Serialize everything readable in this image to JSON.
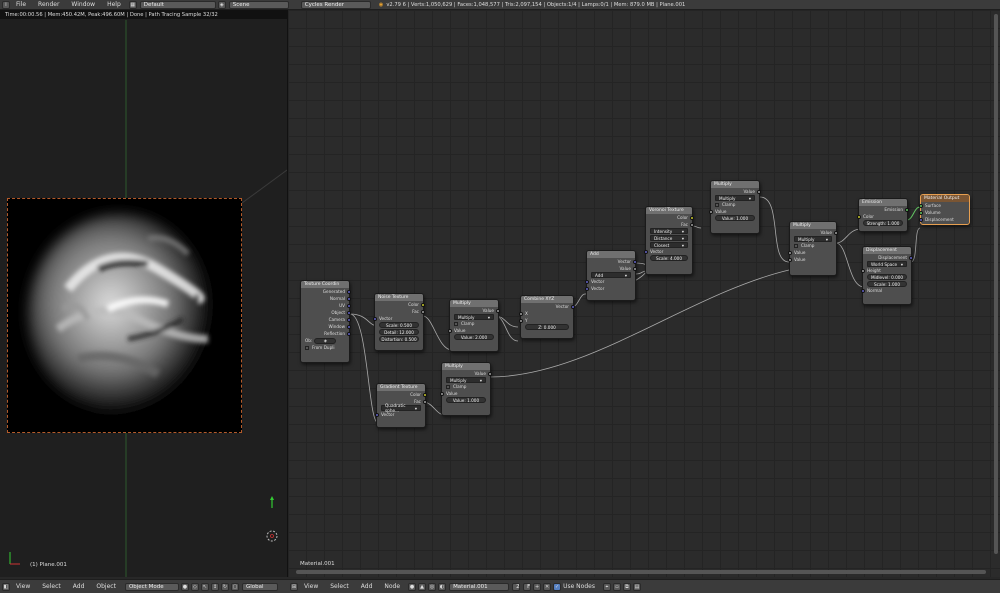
{
  "topbar": {
    "menu": [
      "File",
      "Render",
      "Window",
      "Help"
    ],
    "screen_layout": "Default",
    "scene": "Scene",
    "engine": "Cycles Render",
    "stats": "v2.79 6 | Verts:1,050,629 | Faces:1,048,577 | Tris:2,097,154 | Objects:1/4 | Lamps:0/1 | Mem: 879.0 MB | Plane.001"
  },
  "viewport": {
    "render_status": "Time:00:00.56 | Mem:450.42M, Peak:496.60M | Done | Path Tracing Sample 32/32",
    "object_label": "(1) Plane.001"
  },
  "nodeeditor": {
    "material_label": "Material.001",
    "nodes": {
      "texcoord": {
        "title": "Texture Coordin",
        "outputs": [
          "Generated",
          "Normal",
          "UV",
          "Object",
          "Camera",
          "Window",
          "Reflection"
        ],
        "ob_label": "Ob:",
        "from_dupli": "From Dupli"
      },
      "noise": {
        "title": "Noise Texture",
        "out_color": "Color",
        "out_fac": "Fac",
        "in_vector": "Vector",
        "scale": "Scale: 0.500",
        "detail": "Detail: 12.000",
        "distortion": "Distortion: 0.500"
      },
      "multiply1": {
        "title": "Multiply",
        "out": "Value",
        "op": "Multiply",
        "clamp": "Clamp",
        "in_value": "Value",
        "value2": "Value: 2.000"
      },
      "combine": {
        "title": "Combine XYZ",
        "out": "Vector",
        "x": "X",
        "y": "Y",
        "z": "Z: 0.000"
      },
      "add": {
        "title": "Add",
        "out_vector": "Vector",
        "out_value": "Value",
        "op": "Add",
        "in1": "Vector",
        "in2": "Vector"
      },
      "voronoi": {
        "title": "Voronoi Texture",
        "out_color": "Color",
        "out_fac": "Fac",
        "coloring": "Intensity",
        "metric": "Distance",
        "feature": "Closest",
        "in_vector": "Vector",
        "scale": "Scale: 4.000"
      },
      "multiply2": {
        "title": "Multiply",
        "out": "Value",
        "op": "Multiply",
        "clamp": "Clamp",
        "in_value": "Value",
        "value2": "Value: 1.000"
      },
      "multiply3": {
        "title": "Multiply",
        "out": "Value",
        "op": "Multiply",
        "clamp": "Clamp",
        "in_value": "Value",
        "in_value2": "Value"
      },
      "emission": {
        "title": "Emission",
        "out": "Emission",
        "in_color": "Color",
        "strength": "Strength: 1.000"
      },
      "displacement": {
        "title": "Displacement",
        "out": "Displacement",
        "space": "World Space",
        "height": "Height",
        "midlevel": "Midlevel: 0.000",
        "scale": "Scale: 1.000",
        "normal": "Normal"
      },
      "output": {
        "title": "Material Output",
        "surface": "Surface",
        "volume": "Volume",
        "displacement": "Displacement"
      },
      "gradient": {
        "title": "Gradient Texture",
        "out_color": "Color",
        "out_fac": "Fac",
        "type": "Quadratic sphe...",
        "in_vector": "Vector"
      },
      "multiply4": {
        "title": "Multiply",
        "out": "Value",
        "op": "Multiply",
        "clamp": "Clamp",
        "in_value": "Value",
        "value2": "Value: 1.000"
      }
    }
  },
  "bottombar": {
    "left_menu": [
      "View",
      "Select",
      "Add",
      "Object"
    ],
    "mode": "Object Mode",
    "orientation": "Global",
    "right_menu": [
      "View",
      "Select",
      "Add",
      "Node"
    ],
    "material": "Material.001",
    "users": "2",
    "fake": "F",
    "use_nodes": "Use Nodes"
  },
  "colors": {
    "background": "#282828",
    "header": "#3b3b3b",
    "node": "#4e4e4e",
    "float_socket": "#a1a1a1",
    "color_socket": "#c7c729",
    "vector_socket": "#6363c7",
    "shader_socket": "#63c763",
    "selection": "#e79f50"
  }
}
